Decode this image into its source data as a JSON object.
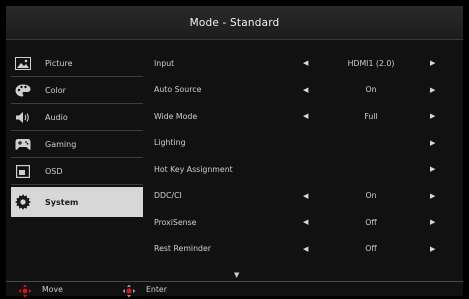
{
  "header": {
    "title": "Mode - Standard"
  },
  "sidebar": {
    "items": [
      {
        "label": "Picture",
        "icon": "picture-icon"
      },
      {
        "label": "Color",
        "icon": "palette-icon"
      },
      {
        "label": "Audio",
        "icon": "speaker-icon"
      },
      {
        "label": "Gaming",
        "icon": "gamepad-icon"
      },
      {
        "label": "OSD",
        "icon": "osd-window-icon"
      },
      {
        "label": "System",
        "icon": "gear-icon",
        "active": true
      }
    ]
  },
  "settings": {
    "rows": [
      {
        "name": "Input",
        "value": "HDMI1 (2.0)"
      },
      {
        "name": "Auto Source",
        "value": "On"
      },
      {
        "name": "Wide Mode",
        "value": "Full"
      },
      {
        "name": "Lighting",
        "value": ""
      },
      {
        "name": "Hot Key Assignment",
        "value": ""
      },
      {
        "name": "DDC/CI",
        "value": "On"
      },
      {
        "name": "ProxiSense",
        "value": "Off"
      },
      {
        "name": "Rest Reminder",
        "value": "Off"
      }
    ],
    "left_arrow": "◀",
    "right_arrow": "▶",
    "more_indicator": "▼"
  },
  "footer": {
    "move_label": "Move",
    "enter_label": "Enter"
  },
  "colors": {
    "background": "#111111",
    "active_tab": "#d7d7d7",
    "accent_red": "#d0191e"
  }
}
